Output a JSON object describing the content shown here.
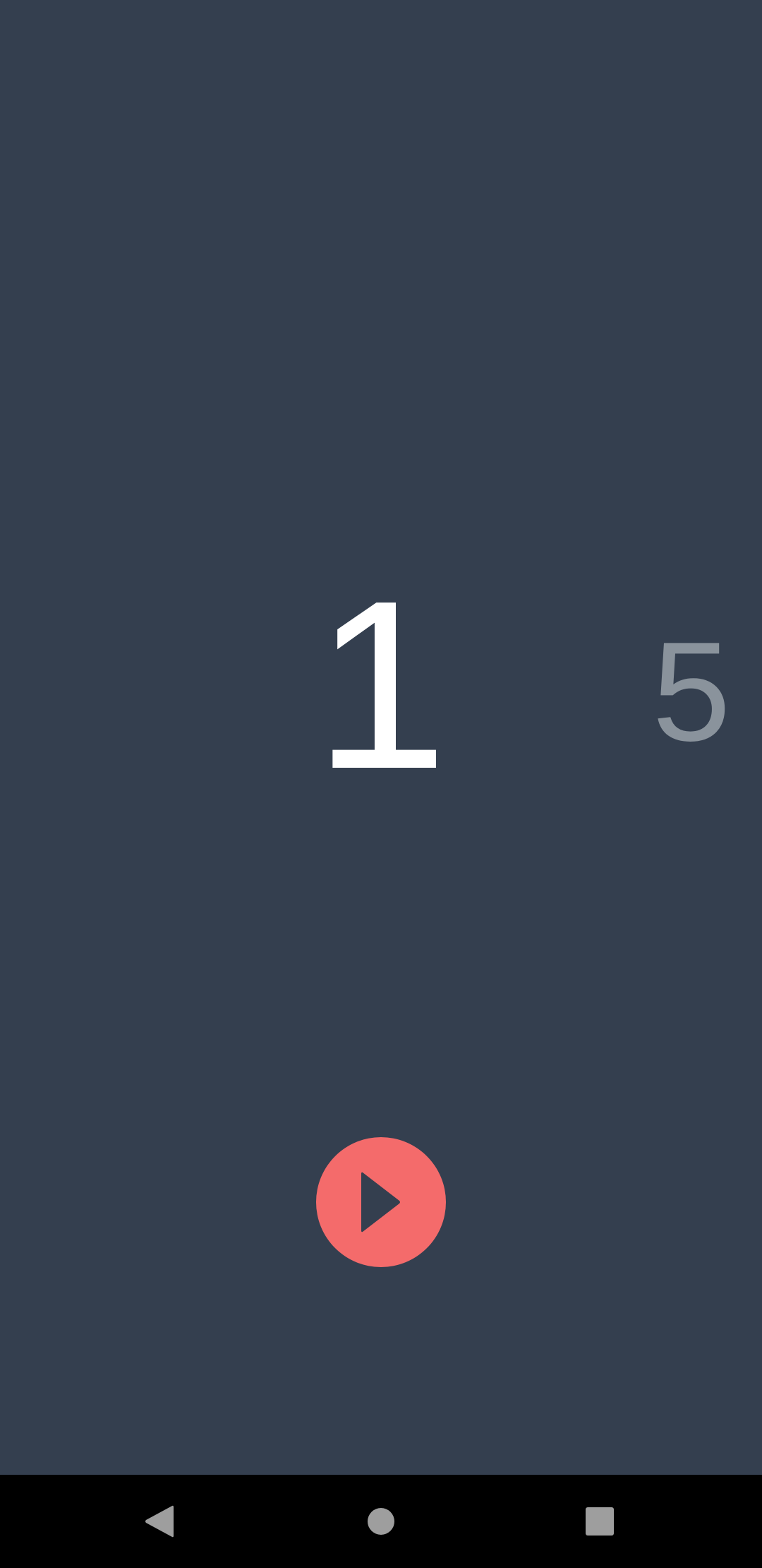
{
  "counter": {
    "current": "1",
    "next": "5"
  },
  "play_button": {
    "icon": "play-icon",
    "color": "#f46b6b"
  },
  "navigation_bar": {
    "back_icon": "back-triangle-icon",
    "home_icon": "home-circle-icon",
    "recents_icon": "recents-square-icon"
  },
  "colors": {
    "background": "#343f4f",
    "current_number": "#ffffff",
    "next_number": "#8a939c",
    "nav_bar": "#000000",
    "nav_icons": "#9e9e9e"
  }
}
